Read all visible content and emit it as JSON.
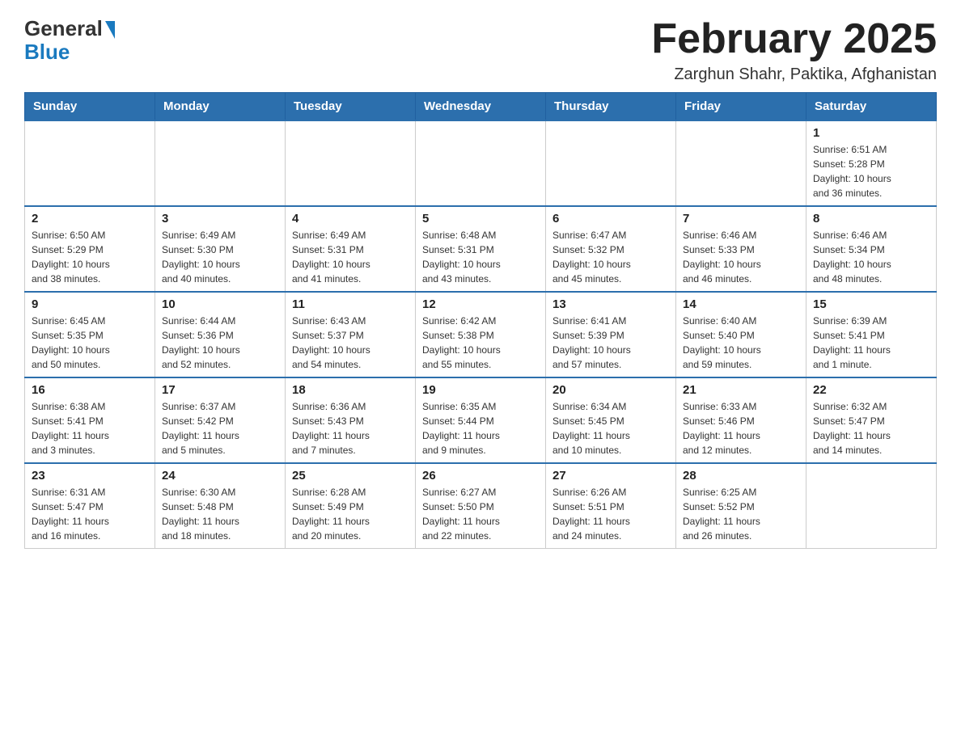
{
  "header": {
    "logo_general": "General",
    "logo_blue": "Blue",
    "title": "February 2025",
    "subtitle": "Zarghun Shahr, Paktika, Afghanistan"
  },
  "weekdays": [
    "Sunday",
    "Monday",
    "Tuesday",
    "Wednesday",
    "Thursday",
    "Friday",
    "Saturday"
  ],
  "weeks": [
    [
      {
        "day": "",
        "info": ""
      },
      {
        "day": "",
        "info": ""
      },
      {
        "day": "",
        "info": ""
      },
      {
        "day": "",
        "info": ""
      },
      {
        "day": "",
        "info": ""
      },
      {
        "day": "",
        "info": ""
      },
      {
        "day": "1",
        "info": "Sunrise: 6:51 AM\nSunset: 5:28 PM\nDaylight: 10 hours\nand 36 minutes."
      }
    ],
    [
      {
        "day": "2",
        "info": "Sunrise: 6:50 AM\nSunset: 5:29 PM\nDaylight: 10 hours\nand 38 minutes."
      },
      {
        "day": "3",
        "info": "Sunrise: 6:49 AM\nSunset: 5:30 PM\nDaylight: 10 hours\nand 40 minutes."
      },
      {
        "day": "4",
        "info": "Sunrise: 6:49 AM\nSunset: 5:31 PM\nDaylight: 10 hours\nand 41 minutes."
      },
      {
        "day": "5",
        "info": "Sunrise: 6:48 AM\nSunset: 5:31 PM\nDaylight: 10 hours\nand 43 minutes."
      },
      {
        "day": "6",
        "info": "Sunrise: 6:47 AM\nSunset: 5:32 PM\nDaylight: 10 hours\nand 45 minutes."
      },
      {
        "day": "7",
        "info": "Sunrise: 6:46 AM\nSunset: 5:33 PM\nDaylight: 10 hours\nand 46 minutes."
      },
      {
        "day": "8",
        "info": "Sunrise: 6:46 AM\nSunset: 5:34 PM\nDaylight: 10 hours\nand 48 minutes."
      }
    ],
    [
      {
        "day": "9",
        "info": "Sunrise: 6:45 AM\nSunset: 5:35 PM\nDaylight: 10 hours\nand 50 minutes."
      },
      {
        "day": "10",
        "info": "Sunrise: 6:44 AM\nSunset: 5:36 PM\nDaylight: 10 hours\nand 52 minutes."
      },
      {
        "day": "11",
        "info": "Sunrise: 6:43 AM\nSunset: 5:37 PM\nDaylight: 10 hours\nand 54 minutes."
      },
      {
        "day": "12",
        "info": "Sunrise: 6:42 AM\nSunset: 5:38 PM\nDaylight: 10 hours\nand 55 minutes."
      },
      {
        "day": "13",
        "info": "Sunrise: 6:41 AM\nSunset: 5:39 PM\nDaylight: 10 hours\nand 57 minutes."
      },
      {
        "day": "14",
        "info": "Sunrise: 6:40 AM\nSunset: 5:40 PM\nDaylight: 10 hours\nand 59 minutes."
      },
      {
        "day": "15",
        "info": "Sunrise: 6:39 AM\nSunset: 5:41 PM\nDaylight: 11 hours\nand 1 minute."
      }
    ],
    [
      {
        "day": "16",
        "info": "Sunrise: 6:38 AM\nSunset: 5:41 PM\nDaylight: 11 hours\nand 3 minutes."
      },
      {
        "day": "17",
        "info": "Sunrise: 6:37 AM\nSunset: 5:42 PM\nDaylight: 11 hours\nand 5 minutes."
      },
      {
        "day": "18",
        "info": "Sunrise: 6:36 AM\nSunset: 5:43 PM\nDaylight: 11 hours\nand 7 minutes."
      },
      {
        "day": "19",
        "info": "Sunrise: 6:35 AM\nSunset: 5:44 PM\nDaylight: 11 hours\nand 9 minutes."
      },
      {
        "day": "20",
        "info": "Sunrise: 6:34 AM\nSunset: 5:45 PM\nDaylight: 11 hours\nand 10 minutes."
      },
      {
        "day": "21",
        "info": "Sunrise: 6:33 AM\nSunset: 5:46 PM\nDaylight: 11 hours\nand 12 minutes."
      },
      {
        "day": "22",
        "info": "Sunrise: 6:32 AM\nSunset: 5:47 PM\nDaylight: 11 hours\nand 14 minutes."
      }
    ],
    [
      {
        "day": "23",
        "info": "Sunrise: 6:31 AM\nSunset: 5:47 PM\nDaylight: 11 hours\nand 16 minutes."
      },
      {
        "day": "24",
        "info": "Sunrise: 6:30 AM\nSunset: 5:48 PM\nDaylight: 11 hours\nand 18 minutes."
      },
      {
        "day": "25",
        "info": "Sunrise: 6:28 AM\nSunset: 5:49 PM\nDaylight: 11 hours\nand 20 minutes."
      },
      {
        "day": "26",
        "info": "Sunrise: 6:27 AM\nSunset: 5:50 PM\nDaylight: 11 hours\nand 22 minutes."
      },
      {
        "day": "27",
        "info": "Sunrise: 6:26 AM\nSunset: 5:51 PM\nDaylight: 11 hours\nand 24 minutes."
      },
      {
        "day": "28",
        "info": "Sunrise: 6:25 AM\nSunset: 5:52 PM\nDaylight: 11 hours\nand 26 minutes."
      },
      {
        "day": "",
        "info": ""
      }
    ]
  ]
}
